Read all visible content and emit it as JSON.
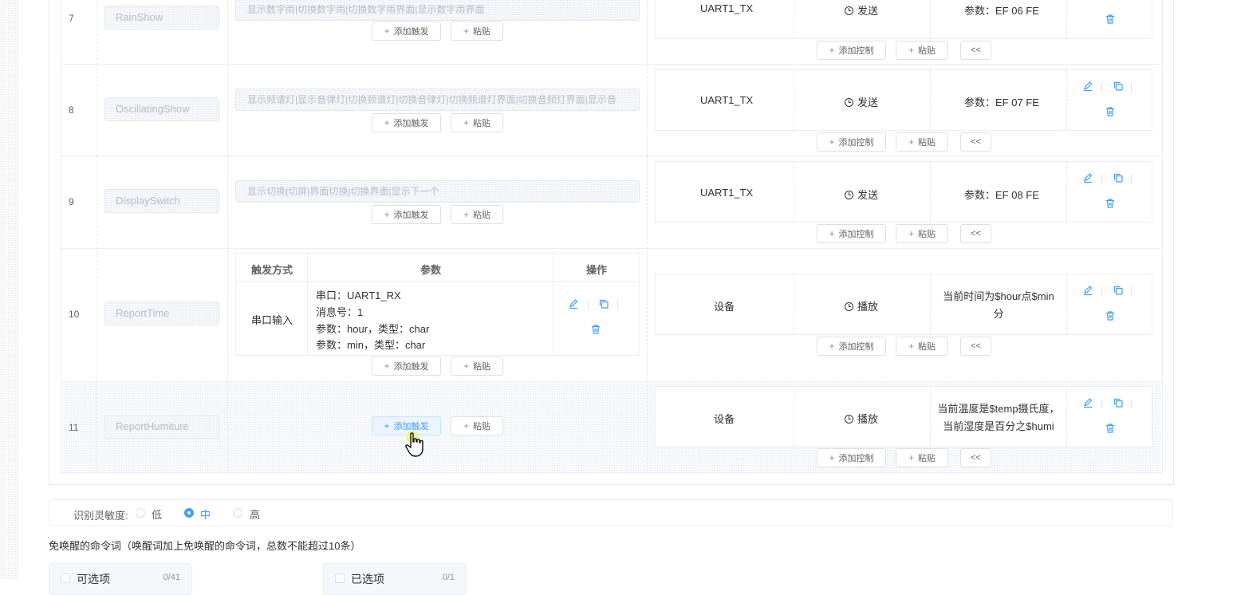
{
  "labels": {
    "add_trigger": "添加触发",
    "paste": "粘贴",
    "add_control": "添加控制",
    "collapse": "<<"
  },
  "rows": [
    {
      "index": "7",
      "name": "RainShow",
      "trigger_text": "显示数字雨|切换数字雨|切换数字雨界面|显示数字雨界面",
      "target": "UART1_TX",
      "action": "发送",
      "param": "参数：EF 06 FE"
    },
    {
      "index": "8",
      "name": "OscillatingShow",
      "trigger_text": "显示频谱灯|显示音律灯|切换频谱灯|切换音律灯|切换频谱灯界面|切换音频灯界面|显示音",
      "target": "UART1_TX",
      "action": "发送",
      "param": "参数：EF 07 FE"
    },
    {
      "index": "9",
      "name": "DisplaySwitch",
      "trigger_text": "显示切换|切屏|界面切换|切换界面|显示下一个",
      "target": "UART1_TX",
      "action": "发送",
      "param": "参数：EF 08 FE"
    },
    {
      "index": "10",
      "name": "ReportTime",
      "target": "设备",
      "action": "播放",
      "param": "当前时间为$hour点$min分",
      "sub_table": {
        "headers": [
          "触发方式",
          "参数",
          "操作"
        ],
        "method": "串口输入",
        "params": [
          "串口：UART1_RX",
          "消息号：1",
          "参数：hour，类型：char",
          "参数：min，类型：char"
        ]
      }
    },
    {
      "index": "11",
      "name": "ReportHumiture",
      "target": "设备",
      "action": "播放",
      "param": "当前温度是$temp摄氏度，当前湿度是百分之$humi"
    }
  ],
  "sensitivity": {
    "label": "识别灵敏度:",
    "options": [
      "低",
      "中",
      "高"
    ],
    "selected": "中"
  },
  "note": "免唤醒的命令词（唤醒词加上免唤醒的命令词，总数不能超过10条）",
  "transfer": {
    "left": {
      "title": "可选项",
      "count": "0/41"
    },
    "right": {
      "title": "已选项",
      "count": "0/1"
    }
  },
  "colors": {
    "accent": "#409eff",
    "border": "#ebeef5",
    "placeholder": "#b8bcc4"
  },
  "icons": [
    "edit-icon",
    "copy-icon",
    "delete-icon",
    "clock-icon",
    "pointer-hand-icon"
  ]
}
